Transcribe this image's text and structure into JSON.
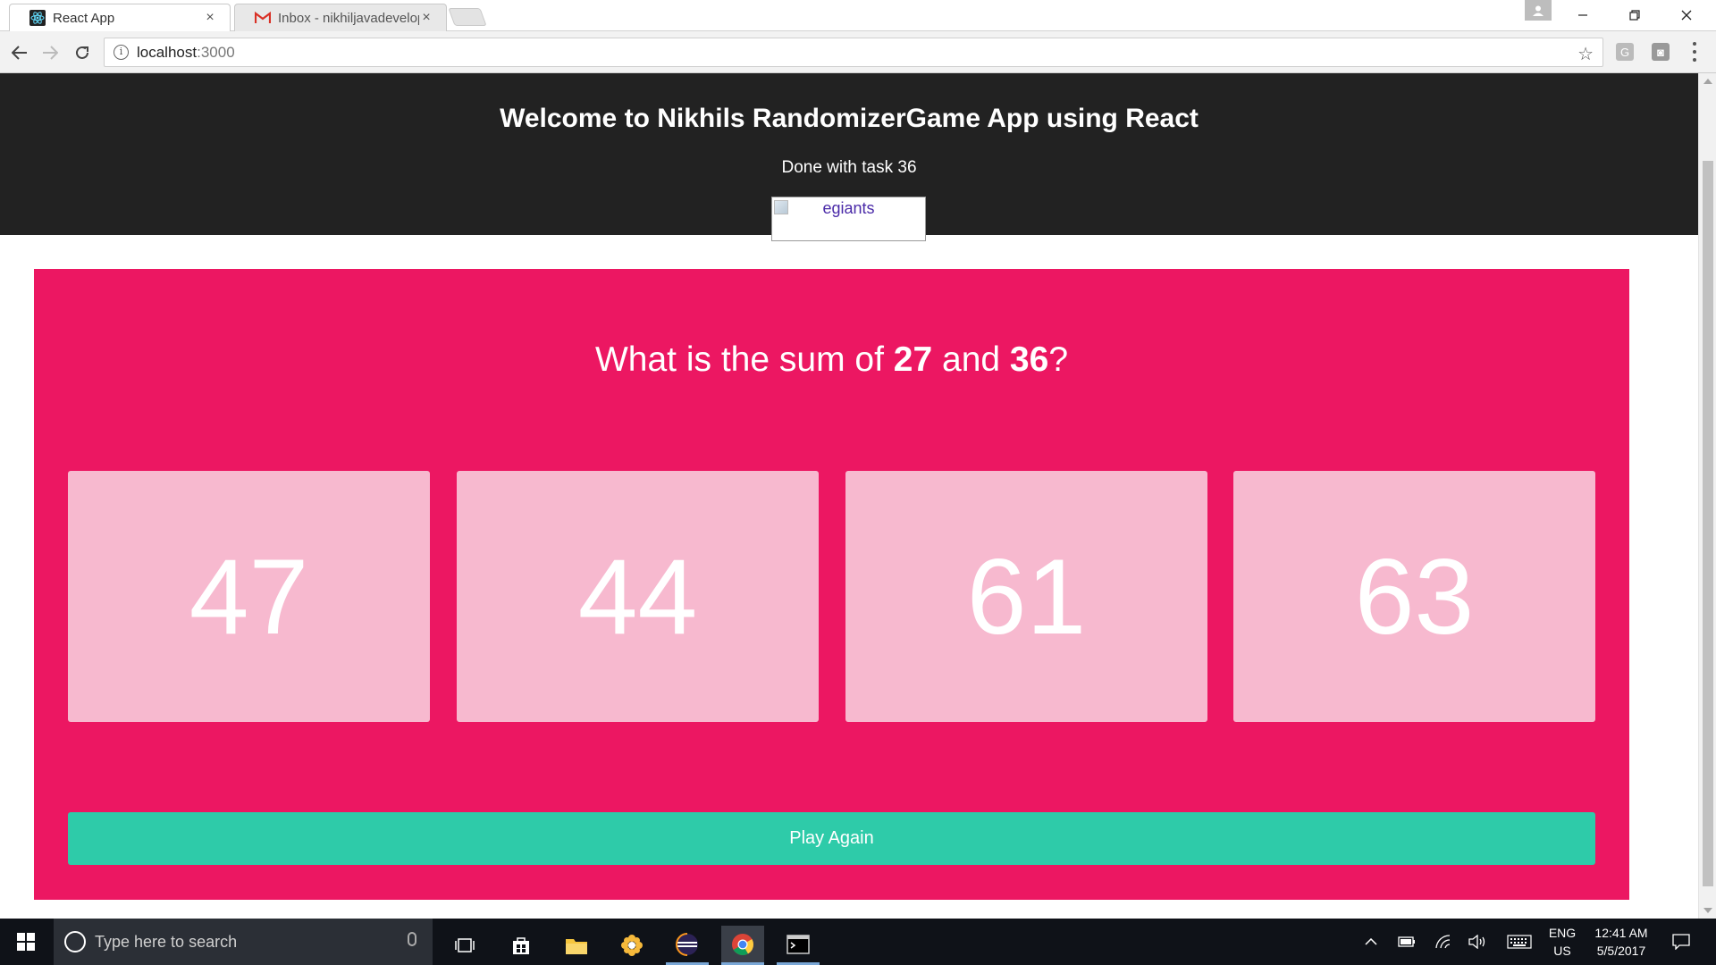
{
  "browser": {
    "tabs": [
      {
        "title": "React App",
        "active": true,
        "favicon": "react-icon"
      },
      {
        "title": "Inbox - nikhiljavadevelop",
        "active": false,
        "favicon": "gmail-icon"
      }
    ],
    "tab_close_glyph": "×",
    "address": {
      "host": "localhost",
      "port": ":3000"
    },
    "extensions": [
      "G",
      "◙"
    ]
  },
  "page": {
    "header": {
      "title": "Welcome to Nikhils RandomizerGame App using React",
      "subtitle": "Done with task 36",
      "image_alt": "egiants"
    },
    "game": {
      "question_prefix": "What is the sum of ",
      "num1": "27",
      "question_mid": " and ",
      "num2": "36",
      "question_suffix": "?",
      "answers": [
        "47",
        "44",
        "61",
        "63"
      ],
      "play_again_label": "Play Again"
    },
    "colors": {
      "header_bg": "#222222",
      "game_bg": "#ec1762",
      "answer_bg": "#f7b9cf",
      "play_button": "#2ecba9"
    }
  },
  "taskbar": {
    "search_placeholder": "Type here to search",
    "language": "ENG",
    "region": "US",
    "time": "12:41 AM",
    "date": "5/5/2017"
  }
}
